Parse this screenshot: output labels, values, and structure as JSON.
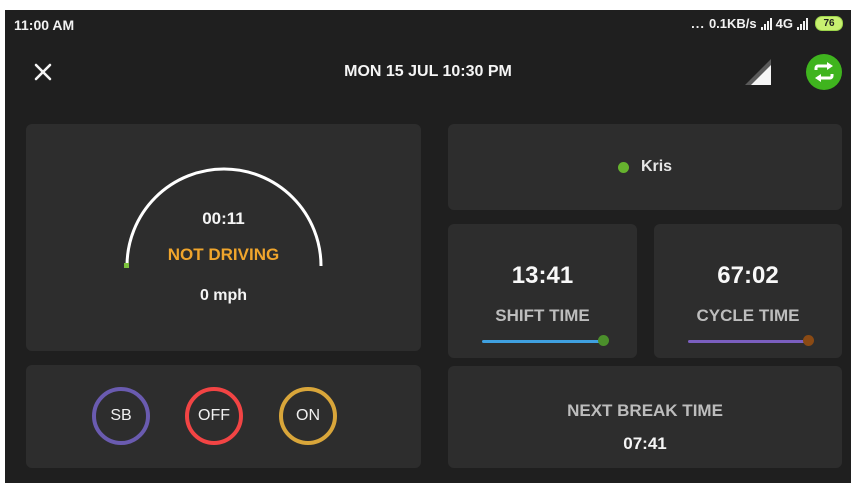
{
  "status_bar": {
    "time": "11:00 AM",
    "dots": "...",
    "network_speed": "0.1KB/s",
    "network_type": "4G",
    "battery": "76",
    "battery_color": "#9bd34a"
  },
  "header": {
    "close_icon": "close-icon",
    "title": "MON 15 JUL 10:30 PM",
    "signal_icon": "cellular-signal-icon",
    "sync_icon": "sync-icon",
    "sync_color": "#3fb41e"
  },
  "gauge": {
    "elapsed": "00:11",
    "status": "NOT DRIVING",
    "status_color": "#f0a52c",
    "speed": "0 mph"
  },
  "duty_status": {
    "sb": {
      "label": "SB",
      "color": "#6a5bb0"
    },
    "off": {
      "label": "OFF",
      "color": "#f24444"
    },
    "on": {
      "label": "ON",
      "color": "#d9a63a"
    }
  },
  "driver": {
    "name": "Kris",
    "status_color": "#66b32e"
  },
  "shift": {
    "value": "13:41",
    "label": "SHIFT TIME",
    "bar_color": "#3fa0e0",
    "knob_color": "#4b8f2b",
    "progress": 1.0
  },
  "cycle": {
    "value": "67:02",
    "label": "CYCLE TIME",
    "bar_color": "#7b5fc0",
    "knob_color": "#8a4a14",
    "progress": 1.0
  },
  "next_break": {
    "label": "NEXT BREAK TIME",
    "value": "07:41"
  }
}
